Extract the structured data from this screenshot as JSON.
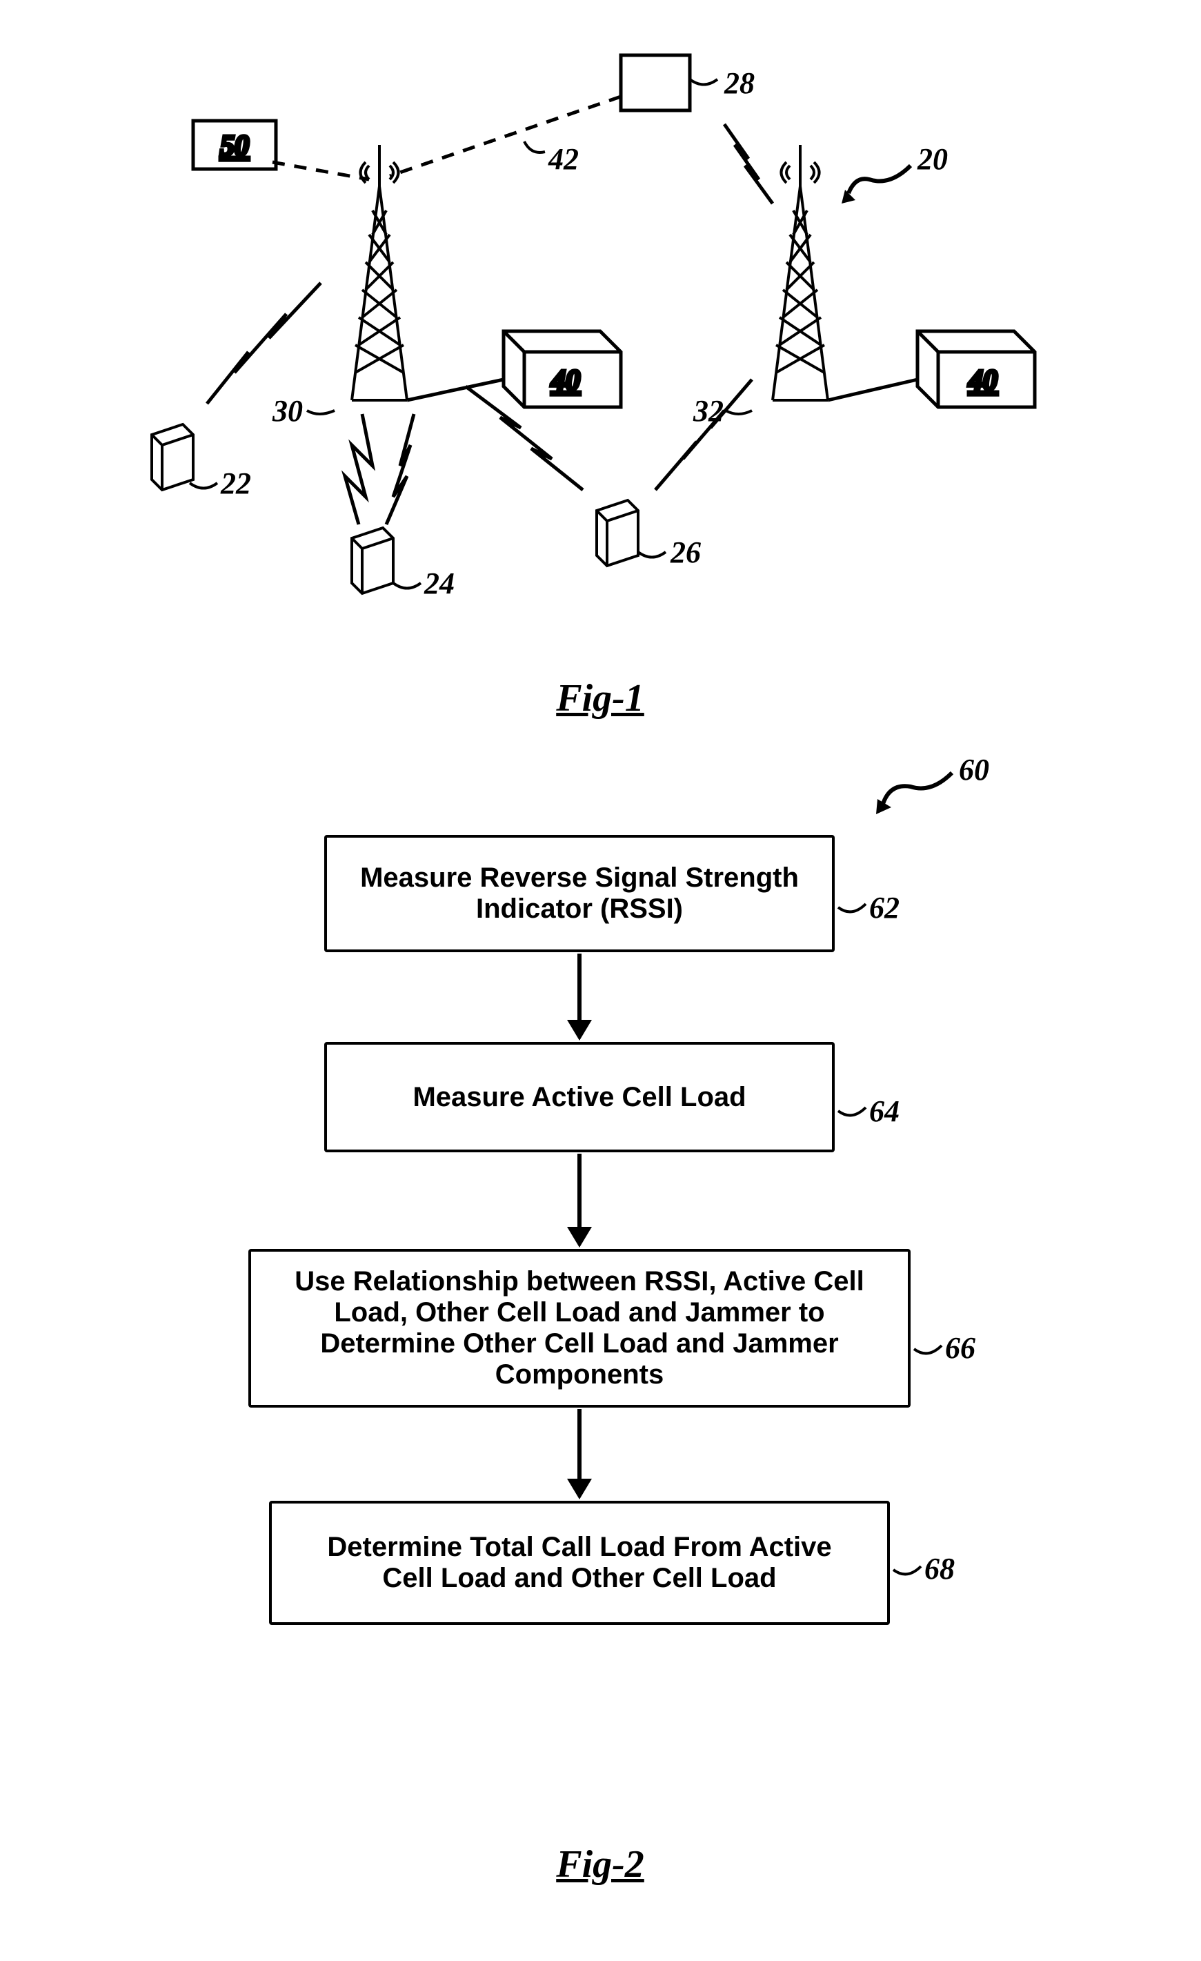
{
  "fig1": {
    "label": "Fig-1",
    "refs": {
      "r20": "20",
      "r22": "22",
      "r24": "24",
      "r26": "26",
      "r28": "28",
      "r30": "30",
      "r32": "32",
      "r40a": "40",
      "r40b": "40",
      "r42": "42",
      "r50": "50"
    }
  },
  "fig2": {
    "label": "Fig-2",
    "refs": {
      "r60": "60",
      "r62": "62",
      "r64": "64",
      "r66": "66",
      "r68": "68"
    },
    "boxes": {
      "b62": "Measure Reverse Signal Strength Indicator (RSSI)",
      "b64": "Measure Active Cell Load",
      "b66": "Use Relationship between RSSI, Active Cell Load, Other Cell Load and Jammer to Determine Other Cell Load and Jammer Components",
      "b68": "Determine Total Call Load From Active Cell Load and Other Cell Load"
    }
  }
}
